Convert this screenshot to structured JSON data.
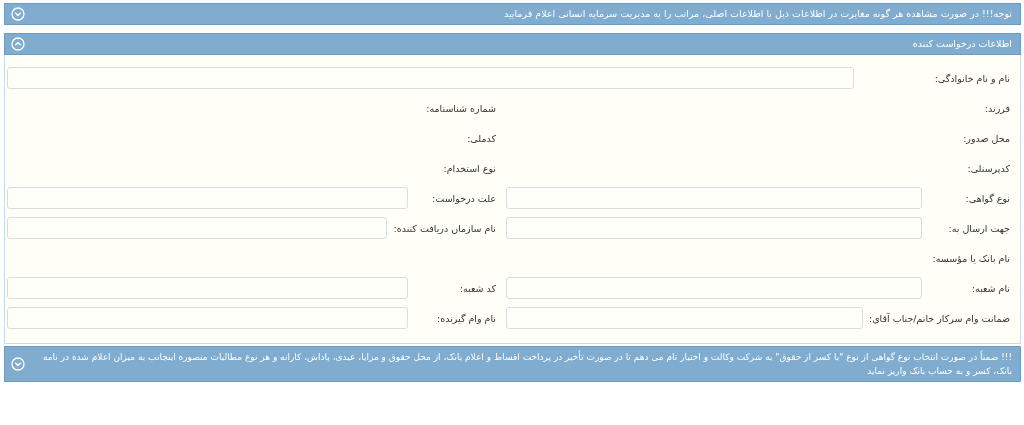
{
  "notice": {
    "text": "توجه!!! در صورت مشاهده هر گونه مغایرت در اطلاعات ذیل با اطلاعات اصلی، مراتب را به مدیریت سرمایه انسانی اعلام فرمایید",
    "expanded": false
  },
  "section": {
    "title": "اطلاعات درخواست کننده",
    "expanded": true,
    "rows": [
      {
        "kind": "wide",
        "cells": [
          {
            "label": "نام و نام خانوادگی:",
            "kind": "input"
          }
        ]
      },
      {
        "kind": "pair",
        "cells": [
          {
            "label": "فرزند:",
            "kind": "static"
          },
          {
            "label": "شماره شناسنامه:",
            "kind": "static"
          }
        ]
      },
      {
        "kind": "pair",
        "cells": [
          {
            "label": "محل صدور:",
            "kind": "static"
          },
          {
            "label": "کدملی:",
            "kind": "static"
          }
        ]
      },
      {
        "kind": "pair",
        "cells": [
          {
            "label": "کدپرسنلی:",
            "kind": "static"
          },
          {
            "label": "نوع استخدام:",
            "kind": "static"
          }
        ]
      },
      {
        "kind": "pair",
        "cells": [
          {
            "label": "نوع گواهی:",
            "kind": "input"
          },
          {
            "label": "علت درخواست:",
            "kind": "input"
          }
        ]
      },
      {
        "kind": "pair",
        "cells": [
          {
            "label": "جهت ارسال به:",
            "kind": "input"
          },
          {
            "label": "نام سازمان دریافت کننده:",
            "kind": "input"
          }
        ]
      },
      {
        "kind": "pair",
        "cells": [
          {
            "label": "نام بانک یا مؤسسه:",
            "kind": "static"
          }
        ]
      },
      {
        "kind": "pair",
        "cells": [
          {
            "label": "نام شعبه:",
            "kind": "input"
          },
          {
            "label": "کد شعبه:",
            "kind": "input"
          }
        ]
      },
      {
        "kind": "pair",
        "cells": [
          {
            "label": "ضمانت وام سرکار خانم/جناب آقای:",
            "kind": "input"
          },
          {
            "label": "نام وام گیرنده:",
            "kind": "input"
          }
        ]
      }
    ]
  },
  "footer_notice": {
    "text": "!!! ضمناً در صورت انتخاب نوع گواهی از نوع \"با کسر از حقوق\" به شرکت وکالت و اختیار تام می دهم تا در صورت تأخیر در پرداخت اقساط و اعلام بانک، از محل حقوق و مزایا، عیدی، پاداش، کارانه و هر نوع مطالبات منصوره اینجانب به میزان اعلام شده در نامه بانک، کسر و به حساب بانک واریز نماید",
    "expanded": false
  }
}
